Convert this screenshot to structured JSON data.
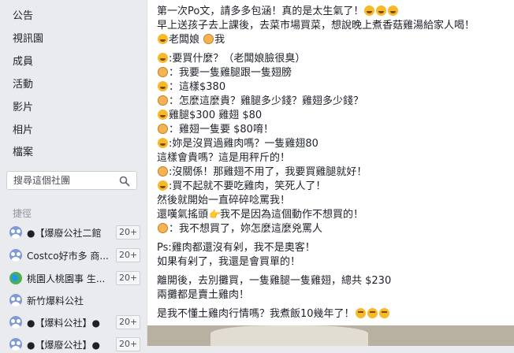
{
  "sidebar": {
    "nav": [
      "公告",
      "視訊園",
      "成員",
      "活動",
      "影片",
      "相片",
      "檔案"
    ],
    "search": {
      "placeholder": "搜尋這個社團"
    },
    "shortcuts_title": "捷徑",
    "shortcuts": [
      {
        "label": "●【爆廢公社二館",
        "count": "20+",
        "icon": "group-icon"
      },
      {
        "label": "Costco好市多 商...",
        "count": "20+",
        "icon": "group-icon"
      },
      {
        "label": "桃園人桃園事 生...",
        "count": "20+",
        "icon": "globe-icon"
      },
      {
        "label": "新竹爆料公社",
        "count": "",
        "icon": "group-icon"
      },
      {
        "label": "●【爆料公社】●",
        "count": "20+",
        "icon": "group-icon"
      },
      {
        "label": "●【爆廢公社】●",
        "count": "20+",
        "icon": "group-icon"
      }
    ]
  },
  "post": {
    "lines": [
      {
        "text": "第一次Po文，請多多包涵！真的是太生氣了！",
        "emoji_after": [
          "laugh",
          "laugh",
          "laugh"
        ]
      },
      {
        "text": "早上送孩子去上課後，去菜市場買菜，想說晚上煮香菇雞湯給家人喝！"
      },
      {
        "emoji_before": [
          "laugh"
        ],
        "text": "老闆娘",
        "emoji_mid": [
          "bun"
        ],
        "text2": "我"
      },
      {
        "emoji_before": [
          "laugh"
        ],
        "text": ":要買什麼？（老闆娘臉很臭）"
      },
      {
        "emoji_before": [
          "bun"
        ],
        "text": "：我要一隻雞腿跟一隻翅膀"
      },
      {
        "emoji_before": [
          "laugh"
        ],
        "text": "：這樣$380"
      },
      {
        "emoji_before": [
          "bun"
        ],
        "text": "：怎麼這麼貴？雞腿多少錢？雞翅多少錢？"
      },
      {
        "emoji_before": [
          "laugh"
        ],
        "text": "雞腿$300 雞翅 $80"
      },
      {
        "emoji_before": [
          "bun"
        ],
        "text": "：雞翅一隻要 $80唷！"
      },
      {
        "emoji_before": [
          "laugh"
        ],
        "text": ":妳是沒買過雞肉嗎？一隻雞翅80"
      },
      {
        "text": "這樣會貴嗎？這是用秤斤的！"
      },
      {
        "emoji_before": [
          "bun"
        ],
        "text": ":沒關係！那雞翅不用了，我要買雞腿就好！"
      },
      {
        "emoji_before": [
          "laugh"
        ],
        "text": ":買不起就不要吃雞肉，笑死人了！"
      },
      {
        "text": "然後就開始一直碎碎唸罵我！"
      },
      {
        "text": "還嘆氣搖頭",
        "emoji_mid": [
          "thumb"
        ],
        "text2": "我不是因為這個動作不想買的！"
      },
      {
        "emoji_before": [
          "bun"
        ],
        "text": "：我不想買了，妳怎麼這麼兇罵人"
      },
      {
        "text": "Ps:雞肉都還沒有剁，我不是奧客！"
      },
      {
        "text": "如果有剁了，我還是會買單的！"
      },
      {
        "text": "離開後，去別攤買，一隻雞腿一隻雞翅，總共 $230"
      },
      {
        "text": "兩攤都是賣土雞肉！"
      },
      {
        "text": "是我不懂土雞肉行情嗎？我煮飯10幾年了！",
        "emoji_after": [
          "sweat",
          "sweat",
          "sweat"
        ]
      }
    ]
  }
}
